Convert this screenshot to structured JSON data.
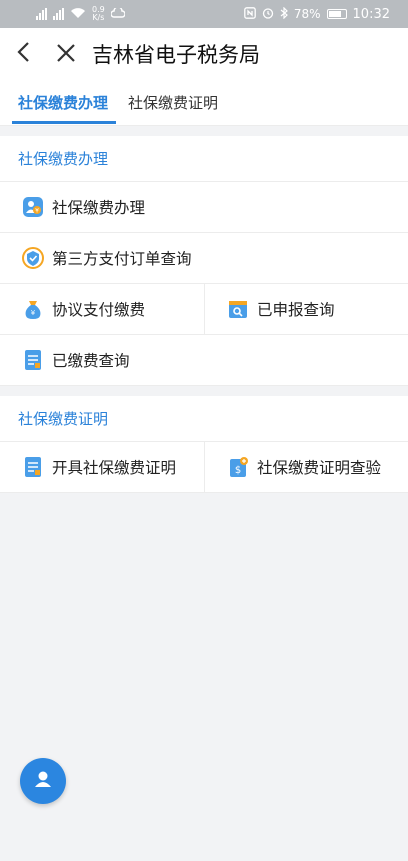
{
  "status_bar": {
    "network_speed_value": "0.9",
    "network_speed_unit": "K/s",
    "battery": "78%",
    "time": "10:32"
  },
  "navbar": {
    "title": "吉林省电子税务局"
  },
  "tabs": [
    {
      "label": "社保缴费办理",
      "active": true
    },
    {
      "label": "社保缴费证明",
      "active": false
    }
  ],
  "sections": [
    {
      "title": "社保缴费办理",
      "items": [
        {
          "label": "社保缴费办理",
          "icon": "social-security-payment-icon"
        },
        {
          "label": "第三方支付订单查询",
          "icon": "third-party-payment-icon"
        },
        {
          "label": "协议支付缴费",
          "icon": "money-bag-icon"
        },
        {
          "label": "已申报查询",
          "icon": "declared-search-icon"
        },
        {
          "label": "已缴费查询",
          "icon": "document-list-icon"
        }
      ]
    },
    {
      "title": "社保缴费证明",
      "items": [
        {
          "label": "开具社保缴费证明",
          "icon": "certificate-document-icon"
        },
        {
          "label": "社保缴费证明查验",
          "icon": "certificate-verify-icon"
        }
      ]
    }
  ],
  "colors": {
    "accent": "#2b82d9",
    "fab": "#2b86e0",
    "icon_orange": "#f5a623"
  }
}
